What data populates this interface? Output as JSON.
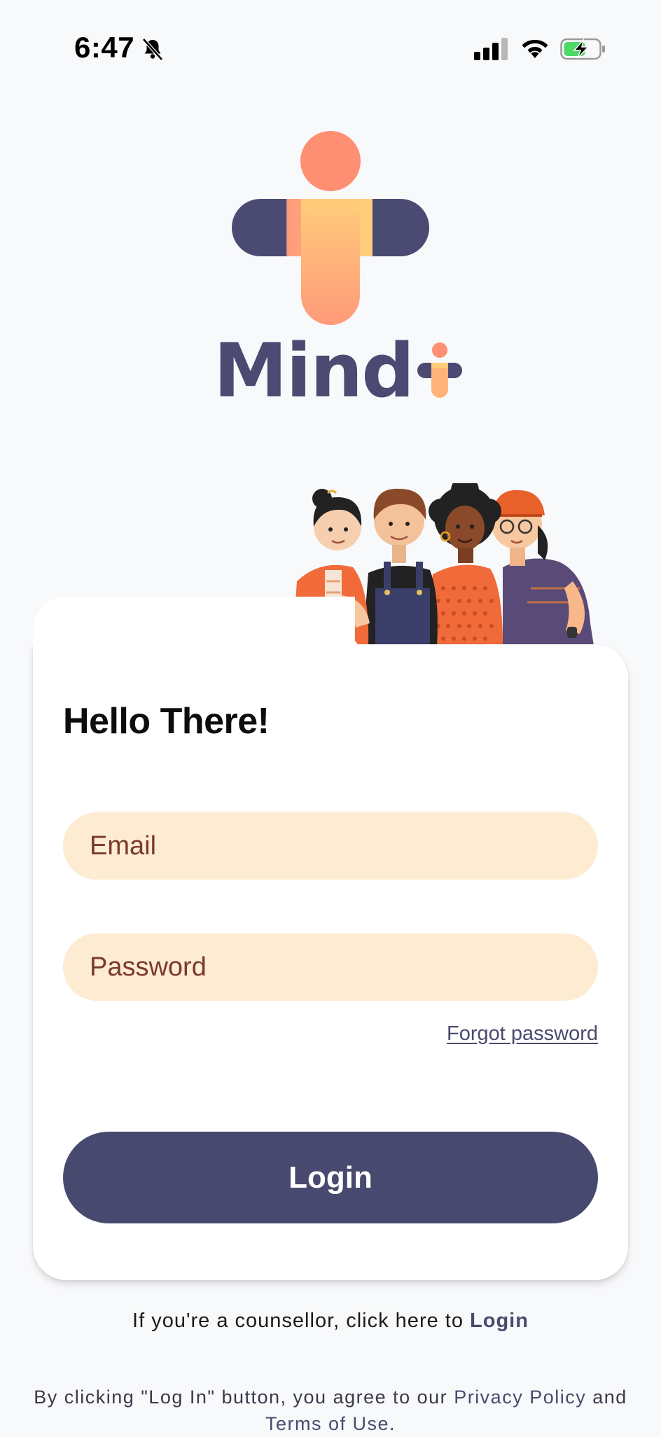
{
  "status_bar": {
    "time": "6:47",
    "icons": [
      "bell-slash-icon",
      "cellular-signal-icon",
      "wifi-icon",
      "battery-charging-icon"
    ]
  },
  "branding": {
    "wordmark": "Mind",
    "colors": {
      "navy": "#4a4a72",
      "coral": "#ff8f73",
      "peach": "#ffcc7a"
    }
  },
  "card": {
    "title": "Hello There!",
    "email": {
      "placeholder": "Email",
      "value": ""
    },
    "password": {
      "placeholder": "Password",
      "value": ""
    },
    "forgot_password": "Forgot password",
    "login_button": "Login"
  },
  "footer": {
    "counsellor_prefix": "If you're a counsellor, click here to",
    "counsellor_link": "Login",
    "legal_prefix": "By clicking \"Log In\" button, you agree to our",
    "privacy_policy": "Privacy Policy",
    "legal_and": "and",
    "terms_of_use": "Terms of Use",
    "legal_suffix": "."
  },
  "colors": {
    "background": "#f8f9fb",
    "input_background": "#fdebd2",
    "input_text": "#7a3a2a",
    "primary_button": "#48496e"
  }
}
